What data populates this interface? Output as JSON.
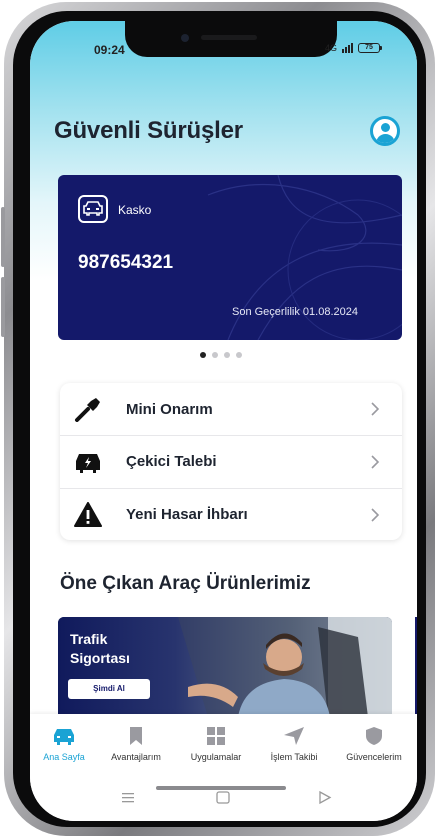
{
  "status_bar": {
    "time": "09:24",
    "network": "4G",
    "signal": "ıl",
    "battery": "75"
  },
  "header": {
    "title": "Güvenli Sürüşler"
  },
  "policy_card": {
    "type": "Kasko",
    "number": "987654321",
    "expiry": "Son Geçerlilik 01.08.2024"
  },
  "carousel": {
    "pages": 4,
    "active": 0
  },
  "actions": [
    {
      "label": "Mini Onarım",
      "icon": "wrench-icon"
    },
    {
      "label": "Çekici Talebi",
      "icon": "car-tow-icon"
    },
    {
      "label": "Yeni Hasar İhbarı",
      "icon": "warning-icon"
    }
  ],
  "products": {
    "title": "Öne Çıkan Araç Ürünlerimiz",
    "banner": {
      "title": "Trafik Sigortası",
      "button": "Şimdi Al"
    }
  },
  "bottom_nav": [
    {
      "label": "Ana Sayfa",
      "icon": "car-icon",
      "active": true
    },
    {
      "label": "Avantajlarım",
      "icon": "bookmark-icon",
      "active": false
    },
    {
      "label": "Uygulamalar",
      "icon": "grid-icon",
      "active": false
    },
    {
      "label": "İşlem Takibi",
      "icon": "send-icon",
      "active": false
    },
    {
      "label": "Güvencelerim",
      "icon": "shield-icon",
      "active": false
    }
  ],
  "colors": {
    "accent": "#1aa3d4",
    "card": "#14196a",
    "text": "#1e2430"
  }
}
